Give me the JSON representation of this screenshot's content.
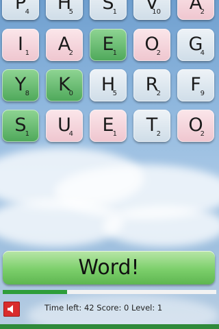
{
  "board": {
    "rows": [
      [
        {
          "letter": "P",
          "score": "4",
          "color": "blue"
        },
        {
          "letter": "H",
          "score": "5",
          "color": "blue"
        },
        {
          "letter": "S",
          "score": "1",
          "color": "blue"
        },
        {
          "letter": "V",
          "score": "10",
          "color": "blue"
        },
        {
          "letter": "A",
          "score": "2",
          "color": "pink"
        }
      ],
      [
        {
          "letter": "I",
          "score": "1",
          "color": "pink"
        },
        {
          "letter": "A",
          "score": "2",
          "color": "pink"
        },
        {
          "letter": "E",
          "score": "1",
          "color": "green"
        },
        {
          "letter": "O",
          "score": "2",
          "color": "pink"
        },
        {
          "letter": "G",
          "score": "4",
          "color": "blue"
        }
      ],
      [
        {
          "letter": "Y",
          "score": "8",
          "color": "green"
        },
        {
          "letter": "K",
          "score": "0",
          "color": "green"
        },
        {
          "letter": "H",
          "score": "5",
          "color": "blue"
        },
        {
          "letter": "R",
          "score": "2",
          "color": "blue"
        },
        {
          "letter": "F",
          "score": "9",
          "color": "blue"
        }
      ],
      [
        {
          "letter": "S",
          "score": "1",
          "color": "green"
        },
        {
          "letter": "U",
          "score": "4",
          "color": "pink"
        },
        {
          "letter": "E",
          "score": "1",
          "color": "pink"
        },
        {
          "letter": "T",
          "score": "2",
          "color": "blue"
        },
        {
          "letter": "O",
          "score": "2",
          "color": "pink"
        }
      ]
    ]
  },
  "word_button": {
    "label": "Word!"
  },
  "progress": {
    "fraction": 0.3
  },
  "status": {
    "time_label": "Time left:",
    "time_value": "42",
    "score_label": "Score:",
    "score_value": "0",
    "level_label": "Level:",
    "level_value": "1"
  },
  "sound_icon": "speaker-icon",
  "colors": {
    "accent_green": "#2e9d3a",
    "sound_red": "#d92c2c"
  }
}
